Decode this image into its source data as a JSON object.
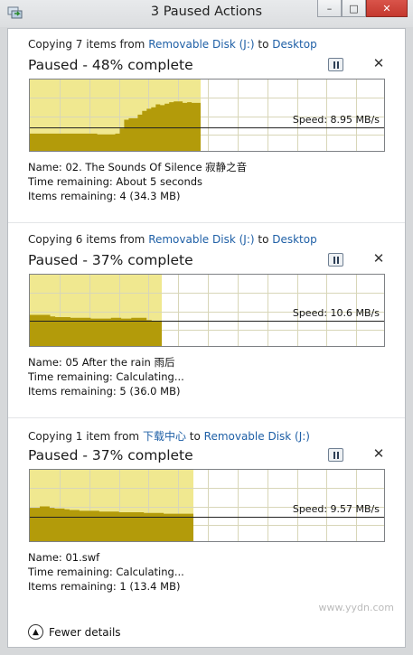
{
  "window": {
    "title": "3 Paused Actions",
    "minimize": "–",
    "maximize": "□",
    "close": "✕"
  },
  "operations": [
    {
      "header": {
        "prefix": "Copying 7 items from ",
        "source": "Removable Disk (J:)",
        "middle": " to ",
        "dest": "Desktop"
      },
      "status": "Paused - 48% complete",
      "progress": 0.48,
      "speed": "Speed: 8.95 MB/s",
      "speed_level": 0.35,
      "history": [
        0.26,
        0.26,
        0.26,
        0.26,
        0.26,
        0.26,
        0.26,
        0.26,
        0.26,
        0.26,
        0.26,
        0.26,
        0.26,
        0.26,
        0.26,
        0.25,
        0.25,
        0.25,
        0.25,
        0.26,
        0.33,
        0.45,
        0.47,
        0.47,
        0.52,
        0.57,
        0.6,
        0.62,
        0.66,
        0.65,
        0.67,
        0.69,
        0.7,
        0.7,
        0.68,
        0.69,
        0.68,
        0.68
      ],
      "name": "Name: 02. The Sounds Of Silence 寂静之音",
      "time": "Time remaining:  About 5 seconds",
      "items": "Items remaining:  4 (34.3 MB)"
    },
    {
      "header": {
        "prefix": "Copying 6 items from ",
        "source": "Removable Disk (J:)",
        "middle": " to ",
        "dest": "Desktop"
      },
      "status": "Paused - 37% complete",
      "progress": 0.37,
      "speed": "Speed: 10.6 MB/s",
      "speed_level": 0.37,
      "history": [
        0.45,
        0.45,
        0.45,
        0.45,
        0.43,
        0.42,
        0.42,
        0.42,
        0.41,
        0.41,
        0.41,
        0.41,
        0.4,
        0.4,
        0.4,
        0.4,
        0.41,
        0.41,
        0.4,
        0.4,
        0.41,
        0.41,
        0.41,
        0.38,
        0.36,
        0.36
      ],
      "name": "Name: 05 After the rain 雨后",
      "time": "Time remaining:  Calculating...",
      "items": "Items remaining:  5 (36.0 MB)"
    },
    {
      "header": {
        "prefix": "Copying 1 item from ",
        "source": "下载中心",
        "middle": " to ",
        "dest": "Removable Disk (J:)"
      },
      "status": "Paused - 37% complete",
      "progress": 0.46,
      "speed": "Speed: 9.57 MB/s",
      "speed_level": 0.36,
      "history": [
        0.48,
        0.48,
        0.5,
        0.5,
        0.48,
        0.47,
        0.47,
        0.46,
        0.45,
        0.45,
        0.44,
        0.44,
        0.44,
        0.44,
        0.43,
        0.43,
        0.43,
        0.43,
        0.42,
        0.42,
        0.42,
        0.42,
        0.42,
        0.41,
        0.41,
        0.41,
        0.41,
        0.4,
        0.4,
        0.4,
        0.4,
        0.4,
        0.4
      ],
      "name": "Name: 01.swf",
      "time": "Time remaining:  Calculating...",
      "items": "Items remaining:  1 (13.4 MB)"
    }
  ],
  "footer": {
    "fewer_details": "Fewer details"
  },
  "watermark": {
    "site": "www.yydn.com"
  },
  "colors": {
    "fill_light": "#f0e890",
    "fill_dark": "#b39b0a",
    "grid": "#d8d6b8",
    "speed_line": "#222222"
  }
}
